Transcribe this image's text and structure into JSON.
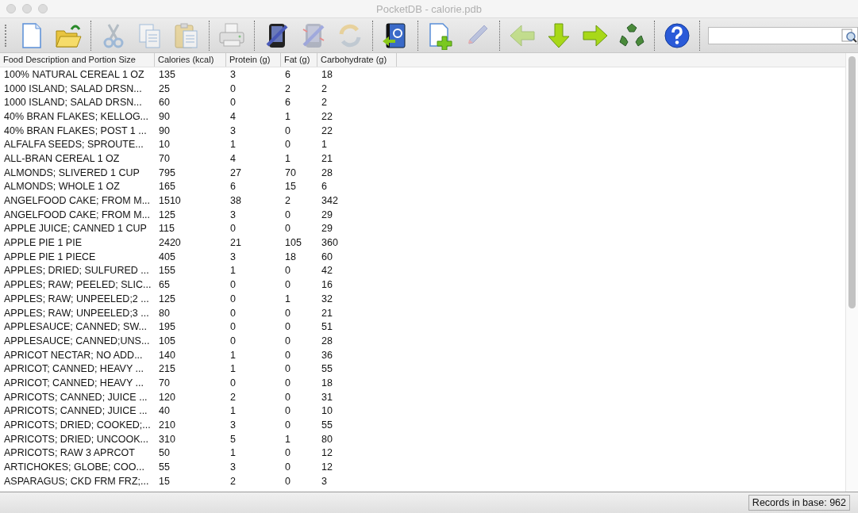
{
  "window": {
    "title": "PocketDB - calorie.pdb"
  },
  "toolbar": [
    {
      "disabled": false
    },
    {
      "disabled": false
    },
    {
      "disabled": true
    },
    {
      "disabled": true
    },
    {
      "disabled": true
    },
    {
      "disabled": true
    },
    {
      "disabled": false
    },
    {
      "disabled": true
    },
    {
      "disabled": true
    },
    {
      "disabled": false
    },
    {
      "disabled": false
    },
    {
      "disabled": true
    },
    {
      "disabled": true
    },
    {
      "disabled": false
    },
    {
      "disabled": false
    },
    {
      "disabled": false
    },
    {
      "disabled": false
    }
  ],
  "table": {
    "columns": [
      "Food Description and Portion Size",
      "Calories (kcal)",
      "Protein (g)",
      "Fat (g)",
      "Carbohydrate (g)"
    ],
    "rows": [
      [
        "100% NATURAL CEREAL 1 OZ",
        "135",
        "3",
        "6",
        "18"
      ],
      [
        "1000 ISLAND; SALAD DRSN...",
        "25",
        "0",
        "2",
        "2"
      ],
      [
        "1000 ISLAND; SALAD DRSN...",
        "60",
        "0",
        "6",
        "2"
      ],
      [
        "40% BRAN FLAKES; KELLOG...",
        "90",
        "4",
        "1",
        "22"
      ],
      [
        "40% BRAN FLAKES; POST 1 ...",
        "90",
        "3",
        "0",
        "22"
      ],
      [
        "ALFALFA SEEDS; SPROUTE...",
        "10",
        "1",
        "0",
        "1"
      ],
      [
        "ALL-BRAN CEREAL 1 OZ",
        "70",
        "4",
        "1",
        "21"
      ],
      [
        "ALMONDS; SLIVERED 1 CUP",
        "795",
        "27",
        "70",
        "28"
      ],
      [
        "ALMONDS; WHOLE 1 OZ",
        "165",
        "6",
        "15",
        "6"
      ],
      [
        "ANGELFOOD CAKE; FROM M...",
        "1510",
        "38",
        "2",
        "342"
      ],
      [
        "ANGELFOOD CAKE; FROM M...",
        "125",
        "3",
        "0",
        "29"
      ],
      [
        "APPLE JUICE; CANNED 1 CUP",
        "115",
        "0",
        "0",
        "29"
      ],
      [
        "APPLE PIE 1 PIE",
        "2420",
        "21",
        "105",
        "360"
      ],
      [
        "APPLE PIE 1 PIECE",
        "405",
        "3",
        "18",
        "60"
      ],
      [
        "APPLES; DRIED; SULFURED ...",
        "155",
        "1",
        "0",
        "42"
      ],
      [
        "APPLES; RAW; PEELED; SLIC...",
        "65",
        "0",
        "0",
        "16"
      ],
      [
        "APPLES; RAW; UNPEELED;2 ...",
        "125",
        "0",
        "1",
        "32"
      ],
      [
        "APPLES; RAW; UNPEELED;3 ...",
        "80",
        "0",
        "0",
        "21"
      ],
      [
        "APPLESAUCE; CANNED; SW...",
        "195",
        "0",
        "0",
        "51"
      ],
      [
        "APPLESAUCE; CANNED;UNS...",
        "105",
        "0",
        "0",
        "28"
      ],
      [
        "APRICOT NECTAR; NO ADD...",
        "140",
        "1",
        "0",
        "36"
      ],
      [
        "APRICOT; CANNED; HEAVY ...",
        "215",
        "1",
        "0",
        "55"
      ],
      [
        "APRICOT; CANNED; HEAVY ...",
        "70",
        "0",
        "0",
        "18"
      ],
      [
        "APRICOTS; CANNED; JUICE ...",
        "120",
        "2",
        "0",
        "31"
      ],
      [
        "APRICOTS; CANNED; JUICE ...",
        "40",
        "1",
        "0",
        "10"
      ],
      [
        "APRICOTS; DRIED; COOKED;...",
        "210",
        "3",
        "0",
        "55"
      ],
      [
        "APRICOTS; DRIED; UNCOOK...",
        "310",
        "5",
        "1",
        "80"
      ],
      [
        "APRICOTS; RAW 3 APRCOT",
        "50",
        "1",
        "0",
        "12"
      ],
      [
        "ARTICHOKES; GLOBE; COO...",
        "55",
        "3",
        "0",
        "12"
      ],
      [
        "ASPARAGUS; CKD FRM FRZ;...",
        "15",
        "2",
        "0",
        "3"
      ]
    ]
  },
  "status_bar": {
    "records": "Records in base: 962"
  }
}
